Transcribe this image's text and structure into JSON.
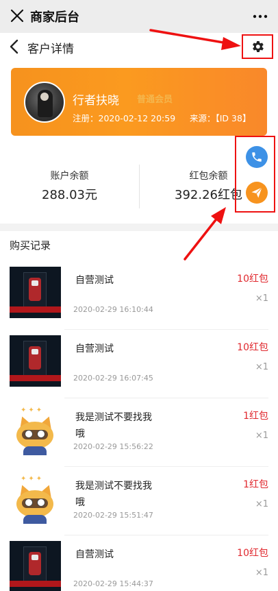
{
  "app": {
    "title": "商家后台"
  },
  "nav": {
    "title": "客户详情"
  },
  "customer": {
    "name": "行者扶晓",
    "watermark": "普通会员",
    "register": "注册：2020-02-12 20:59",
    "source": "来源：【ID 38】"
  },
  "balance": {
    "account_label": "账户余额",
    "account_value": "288.03元",
    "redpacket_label": "红包余额",
    "redpacket_value": "392.26红包"
  },
  "records": {
    "title": "购买记录",
    "items": [
      {
        "name": "自营测试",
        "time": "2020-02-29 16:10:44",
        "price": "10红包",
        "qty": "×1",
        "thumb": "robot-display"
      },
      {
        "name": "自营测试",
        "time": "2020-02-29 16:07:45",
        "price": "10红包",
        "qty": "×1",
        "thumb": "robot-display"
      },
      {
        "name": "我是测试不要找我哦",
        "time": "2020-02-29 15:56:22",
        "price": "1红包",
        "qty": "×1",
        "thumb": "cat-mascot"
      },
      {
        "name": "我是测试不要找我哦",
        "time": "2020-02-29 15:51:47",
        "price": "1红包",
        "qty": "×1",
        "thumb": "cat-mascot"
      },
      {
        "name": "自营测试",
        "time": "2020-02-29 15:44:37",
        "price": "10红包",
        "qty": "×1",
        "thumb": "robot-display"
      }
    ]
  },
  "colors": {
    "accent": "#f7931e",
    "price": "#e0282e",
    "phone": "#3d91e6",
    "annotation": "#e11111"
  }
}
